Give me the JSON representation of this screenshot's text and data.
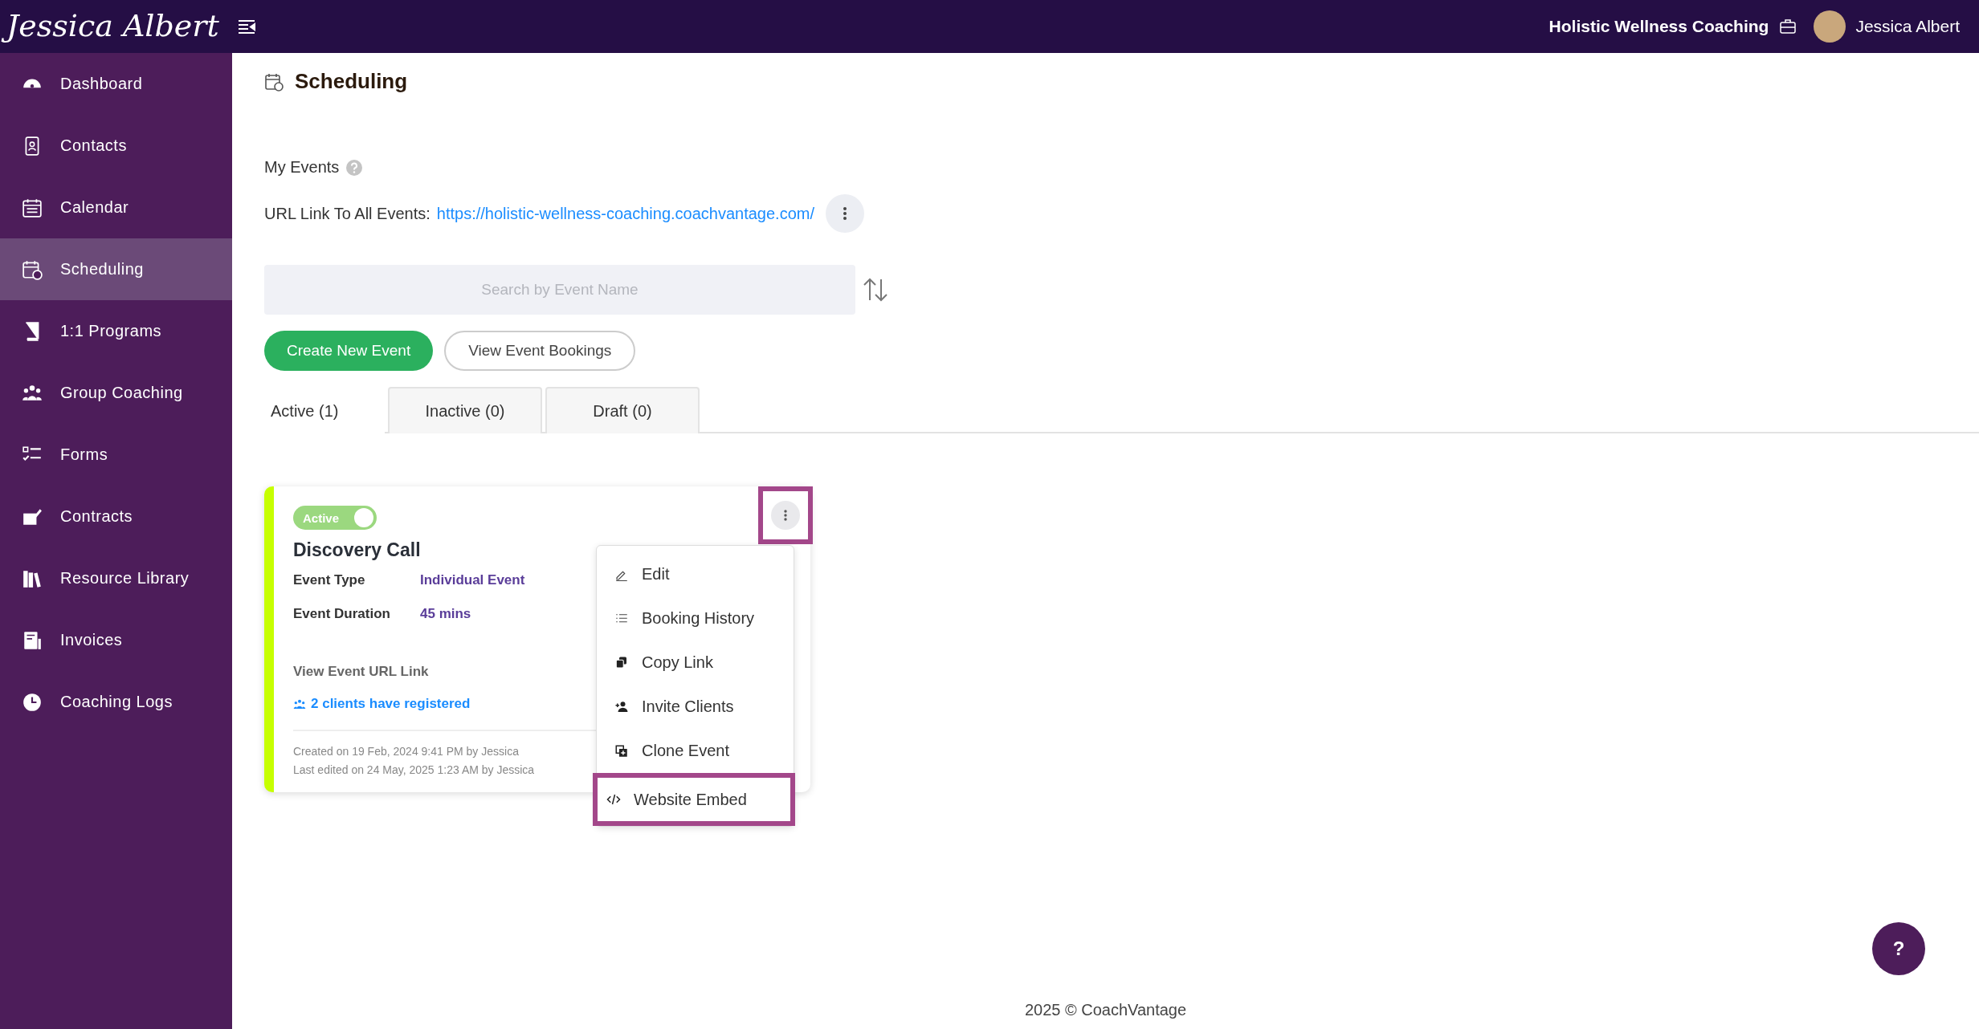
{
  "topbar": {
    "logo": "Jessica Albert",
    "business": "Holistic Wellness Coaching",
    "user": "Jessica Albert"
  },
  "sidebar": {
    "items": [
      {
        "label": "Dashboard",
        "selected": false
      },
      {
        "label": "Contacts",
        "selected": false
      },
      {
        "label": "Calendar",
        "selected": false
      },
      {
        "label": "Scheduling",
        "selected": true
      },
      {
        "label": "1:1 Programs",
        "selected": false
      },
      {
        "label": "Group Coaching",
        "selected": false
      },
      {
        "label": "Forms",
        "selected": false
      },
      {
        "label": "Contracts",
        "selected": false
      },
      {
        "label": "Resource Library",
        "selected": false
      },
      {
        "label": "Invoices",
        "selected": false
      },
      {
        "label": "Coaching Logs",
        "selected": false
      }
    ]
  },
  "page": {
    "title": "Scheduling",
    "section": "My Events",
    "url_label": "URL Link To All Events:",
    "url": "https://holistic-wellness-coaching.coachvantage.com/",
    "search": {
      "placeholder": "Search by Event Name"
    },
    "buttons": [
      "Create New Event",
      "View Event Bookings"
    ],
    "tabs": [
      {
        "label": "Active (1)",
        "selected": true
      },
      {
        "label": "Inactive (0)",
        "selected": false
      },
      {
        "label": "Draft (0)",
        "selected": false
      }
    ]
  },
  "event": {
    "status": "Active",
    "on": true,
    "name": "Discovery Call",
    "menu_highlighted": true,
    "fields": [
      {
        "label": "Event Type",
        "value": "Individual Event"
      },
      {
        "label": "Event Duration",
        "value": "45 mins"
      }
    ],
    "url_link": "View Event URL Link",
    "registered": "2 clients have registered",
    "created": "Created on 19 Feb, 2024 9:41 PM by Jessica",
    "edited": "Last edited on 24 May, 2025 1:23 AM by Jessica"
  },
  "menu": {
    "items": [
      {
        "label": "Edit",
        "highlighted": false
      },
      {
        "label": "Booking History",
        "highlighted": false
      },
      {
        "label": "Copy Link",
        "highlighted": false
      },
      {
        "label": "Invite Clients",
        "highlighted": false
      },
      {
        "label": "Clone Event",
        "highlighted": false
      },
      {
        "label": "Website Embed",
        "highlighted": true
      }
    ]
  },
  "footer": "2025 © CoachVantage",
  "help": "?"
}
